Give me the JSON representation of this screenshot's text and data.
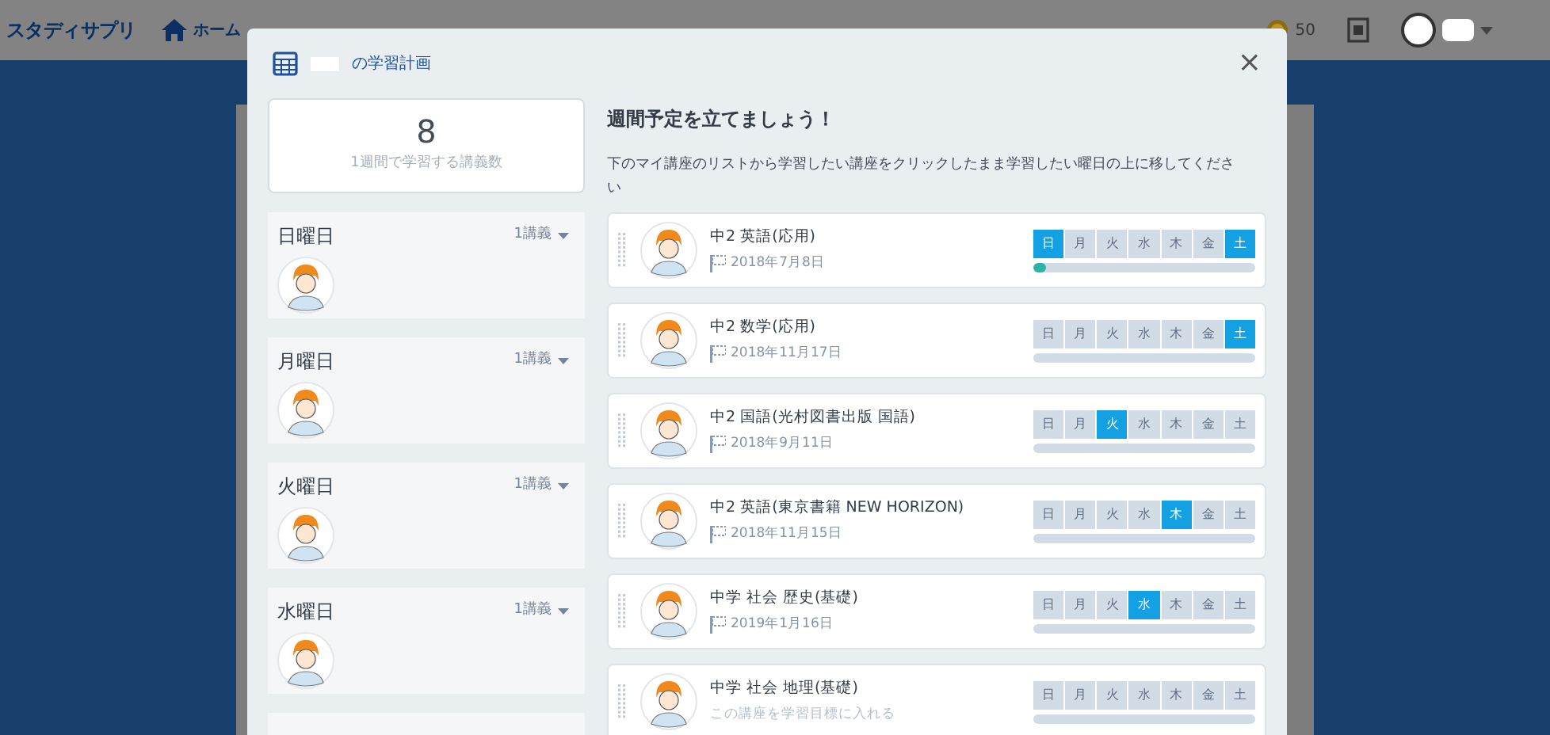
{
  "nav": {
    "logo": "スタディサプリ",
    "home": "ホーム",
    "coins": "50"
  },
  "modal": {
    "title": "の学習計画",
    "close": "×",
    "summary": {
      "count": "8",
      "caption": "1週間で学習する講義数"
    },
    "days": [
      {
        "name": "日曜日",
        "count": "1講義"
      },
      {
        "name": "月曜日",
        "count": "1講義"
      },
      {
        "name": "火曜日",
        "count": "1講義"
      },
      {
        "name": "水曜日",
        "count": "1講義"
      }
    ],
    "heading": "週間予定を立てましょう！",
    "instruction": "下のマイ講座のリストから学習したい講座をクリックしたまま学習したい曜日の上に移してください",
    "courses": [
      {
        "title": "中2 英語(応用)",
        "kind": "deadline",
        "sub": "2018年7月8日",
        "level": 0.06,
        "weekdays": [
          {
            "label": "日",
            "selected": true
          },
          {
            "label": "月",
            "selected": false
          },
          {
            "label": "火",
            "selected": false
          },
          {
            "label": "水",
            "selected": false
          },
          {
            "label": "木",
            "selected": false
          },
          {
            "label": "金",
            "selected": false
          },
          {
            "label": "土",
            "selected": true
          }
        ]
      },
      {
        "title": "中2 数学(応用)",
        "kind": "deadline",
        "sub": "2018年11月17日",
        "level": 0,
        "weekdays": [
          {
            "label": "日",
            "selected": false
          },
          {
            "label": "月",
            "selected": false
          },
          {
            "label": "火",
            "selected": false
          },
          {
            "label": "水",
            "selected": false
          },
          {
            "label": "木",
            "selected": false
          },
          {
            "label": "金",
            "selected": false
          },
          {
            "label": "土",
            "selected": true
          }
        ]
      },
      {
        "title": "中2 国語(光村図書出版 国語)",
        "kind": "deadline",
        "sub": "2018年9月11日",
        "level": 0,
        "weekdays": [
          {
            "label": "日",
            "selected": false
          },
          {
            "label": "月",
            "selected": false
          },
          {
            "label": "火",
            "selected": true
          },
          {
            "label": "水",
            "selected": false
          },
          {
            "label": "木",
            "selected": false
          },
          {
            "label": "金",
            "selected": false
          },
          {
            "label": "土",
            "selected": false
          }
        ]
      },
      {
        "title": "中2 英語(東京書籍 NEW HORIZON)",
        "kind": "deadline",
        "sub": "2018年11月15日",
        "level": 0,
        "weekdays": [
          {
            "label": "日",
            "selected": false
          },
          {
            "label": "月",
            "selected": false
          },
          {
            "label": "火",
            "selected": false
          },
          {
            "label": "水",
            "selected": false
          },
          {
            "label": "木",
            "selected": true
          },
          {
            "label": "金",
            "selected": false
          },
          {
            "label": "土",
            "selected": false
          }
        ]
      },
      {
        "title": "中学 社会 歴史(基礎)",
        "kind": "deadline",
        "sub": "2019年1月16日",
        "level": 0,
        "weekdays": [
          {
            "label": "日",
            "selected": false
          },
          {
            "label": "月",
            "selected": false
          },
          {
            "label": "火",
            "selected": false
          },
          {
            "label": "水",
            "selected": true
          },
          {
            "label": "木",
            "selected": false
          },
          {
            "label": "金",
            "selected": false
          },
          {
            "label": "土",
            "selected": false
          }
        ]
      },
      {
        "title": "中学 社会 地理(基礎)",
        "kind": "prompt",
        "sub": "この講座を学習目標に入れる",
        "level": 0,
        "weekdays": [
          {
            "label": "日",
            "selected": false
          },
          {
            "label": "月",
            "selected": false
          },
          {
            "label": "火",
            "selected": false
          },
          {
            "label": "水",
            "selected": false
          },
          {
            "label": "木",
            "selected": false
          },
          {
            "label": "金",
            "selected": false
          },
          {
            "label": "土",
            "selected": false
          }
        ]
      }
    ]
  }
}
